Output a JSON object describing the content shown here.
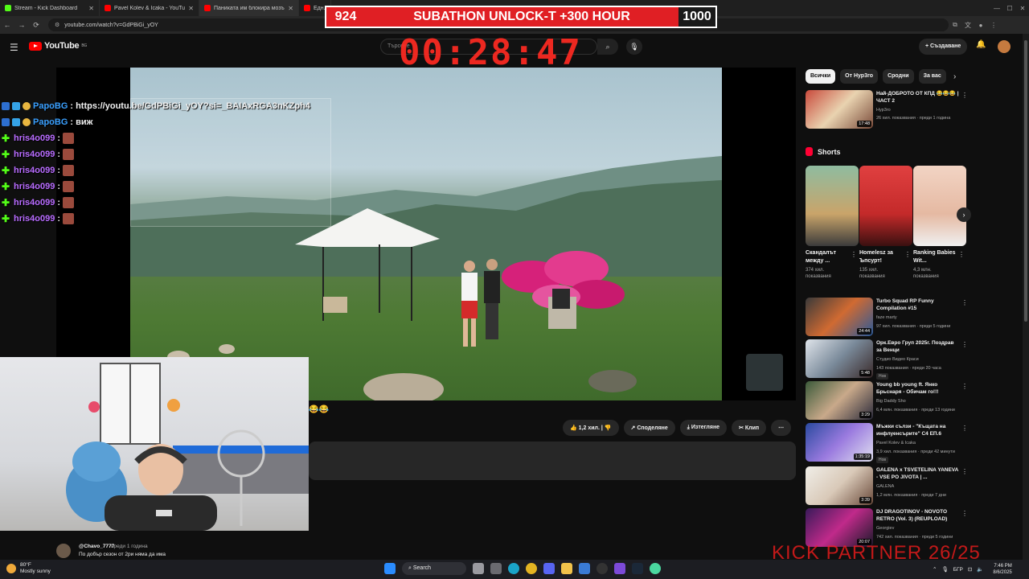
{
  "browser": {
    "tabs": [
      {
        "title": "Stream - Kick Dashboard",
        "color": "#53fc18"
      },
      {
        "title": "Pavel Kolev & Icaka - YouTube",
        "color": "#ff0000"
      },
      {
        "title": "Паниката им блокира мозъ...",
        "color": "#ff0000"
      },
      {
        "title": "Едн...",
        "color": "#ff0000"
      }
    ],
    "url": "youtube.com/watch?v=GdPBiGi_yOY"
  },
  "youtube": {
    "logo_text": "YouTube",
    "logo_sup": "BG",
    "search_placeholder": "Търсене",
    "create_label": "+ Създаване"
  },
  "video_actions": {
    "likes": "1,2 хил.",
    "share": "Споделяне",
    "download": "Изтегляне",
    "clip": "Клип"
  },
  "comment": {
    "user": "@Chavo_7777",
    "time": "преди 1 година",
    "text": "По добър сезон от 2ри няма да има"
  },
  "sidebar": {
    "chips": [
      "Всички",
      "От Нур3го",
      "Сродни",
      "За вас"
    ],
    "active_chip": 0,
    "top_rec": {
      "title": "Най-ДОБРОТО ОТ КПД 😂😂😂 | ЧАСТ 2",
      "channel": "Нур3го",
      "meta": "26 хил. показвания · преди 1 година",
      "duration": "17:48"
    },
    "shorts_heading": "Shorts",
    "shorts": [
      {
        "title": "Скандалът между ...",
        "views": "374 хил. показвания"
      },
      {
        "title": "Homelesz за Ъпсурт!",
        "views": "135 хил. показвания"
      },
      {
        "title": "Ranking Babies Wit...",
        "views": "4,3 млн. показвания"
      }
    ],
    "recs": [
      {
        "title": "Turbo Squad RP Funny Compilation #15",
        "channel": "faze marty",
        "meta": "97 хил. показвания · преди 5 години",
        "duration": "24:44",
        "badge": ""
      },
      {
        "title": "Орк.Евро Груп 2025г. Поздрав за Венци",
        "channel": "Студио Видео Краси",
        "meta": "143 показвания · преди 20 часа",
        "duration": "5:48",
        "badge": "Нов"
      },
      {
        "title": "Young bb young ft. Янко Брьснаря - Обичам го!!!",
        "channel": "Big Daddy Sho",
        "meta": "6,4 млн. показвания · преди 13 години",
        "duration": "3:29",
        "badge": ""
      },
      {
        "title": "Мъжки сълзи - \"Къщата на инфлуенсърите\" С4 ЕП.6",
        "channel": "Pavel Kolev & Icaka",
        "meta": "3,9 хил. показвания · преди 42 минути",
        "duration": "1:35:19",
        "badge": "Нов"
      },
      {
        "title": "GALENA x TSVETELINA YANEVA - VSE PO JIVOTA | ...",
        "channel": "GALENA",
        "meta": "1,2 млн. показвания · преди 7 дни",
        "duration": "3:39",
        "badge": ""
      },
      {
        "title": "DJ DRAGOTINOV - NOVOTO RETRO (Vol. 3) (REUPLOAD)",
        "channel": "Georgiev",
        "meta": "742 хил. показвания · преди 5 години",
        "duration": "20:07",
        "badge": ""
      }
    ]
  },
  "overlay": {
    "chat": [
      {
        "user": "PapoBG",
        "text": "https://youtu.be/GdPBiGi_yOY?si=_BAIAxRGA3nKZph4",
        "user_color": "#3aa0ff",
        "badges": true
      },
      {
        "user": "PapoBG",
        "text": "виж",
        "user_color": "#3aa0ff",
        "badges": true
      },
      {
        "user": "hris4o099",
        "text": "",
        "user_color": "#b86cff",
        "badges": false
      },
      {
        "user": "hris4o099",
        "text": "",
        "user_color": "#b86cff",
        "badges": false
      },
      {
        "user": "hris4o099",
        "text": "",
        "user_color": "#b86cff",
        "badges": false
      },
      {
        "user": "hris4o099",
        "text": "",
        "user_color": "#b86cff",
        "badges": false
      },
      {
        "user": "hris4o099",
        "text": "",
        "user_color": "#b86cff",
        "badges": false
      },
      {
        "user": "hris4o099",
        "text": "",
        "user_color": "#b86cff",
        "badges": false
      }
    ],
    "subathon_left": "924",
    "subathon_title": "SUBATHON UNLOCK-T +300 HOUR",
    "subathon_right": "1000",
    "timer": "00:28:47",
    "partner_text": "KICK PARTNER 26/25",
    "subathon_color": "#e01f24",
    "timer_color": "#ff2a22"
  },
  "taskbar": {
    "weather_temp": "80°F",
    "weather_desc": "Mostly sunny",
    "search_label": "Search",
    "lang": "БГР",
    "time": "7:46 PM",
    "date": "8/6/2025"
  }
}
